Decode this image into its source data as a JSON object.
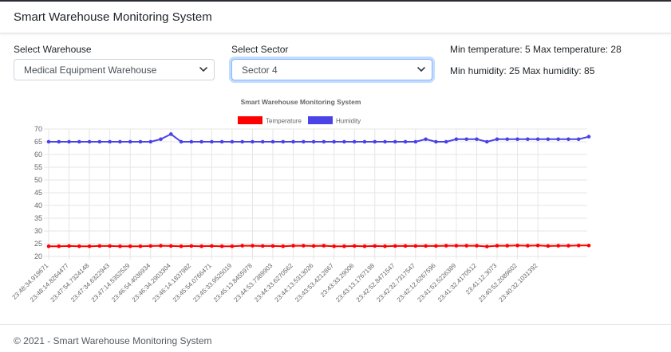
{
  "app": {
    "title": "Smart Warehouse Monitoring System"
  },
  "filters": {
    "warehouse": {
      "label": "Select Warehouse",
      "value": "Medical Equipment Warehouse"
    },
    "sector": {
      "label": "Select Sector",
      "value": "Sector 4"
    }
  },
  "ranges": {
    "temperature": "Min temperature: 5 Max temperature: 28",
    "humidity": "Min humidity: 25 Max humidity: 85"
  },
  "footer": {
    "text": "© 2021 - Smart Warehouse Monitoring System"
  },
  "colors": {
    "temperature": "#ff0000",
    "humidity": "#4a43e6",
    "grid": "#e6e6e6"
  },
  "chart_data": {
    "type": "line",
    "title": "Smart Warehouse Monitoring System",
    "legend_position": "top",
    "grid": true,
    "ylim": [
      20,
      70
    ],
    "yticks": [
      20,
      25,
      30,
      35,
      40,
      45,
      50,
      55,
      60,
      65,
      70
    ],
    "x_tick_labels": [
      "23:48:34.919671",
      "23:48:14.8264477",
      "23:47:54.7324148",
      "23:47:34.6322943",
      "23:47:14.5352529",
      "23:46:54.4036934",
      "23:46:34.2903304",
      "23:46:14.1837982",
      "23:45:54.0766471",
      "23:45:33.9525019",
      "23:45:13.8455978",
      "23:44:53.7389903",
      "23:44:33.6270562",
      "23:44:13.5313026",
      "23:43:53.4212867",
      "23:43:33.29006",
      "23:43:13.1767198",
      "23:42:52.8471547",
      "23:42:32.7317547",
      "23:42:12.6267596",
      "23:41:52.5226389",
      "23:41:32.4170512",
      "23:41:12.3073",
      "23:40:52.2089602",
      "23:40:32.1031392"
    ],
    "series": [
      {
        "name": "Temperature",
        "color": "#ff0000",
        "values": [
          24,
          24,
          24.1,
          24,
          24,
          24.1,
          24.1,
          24,
          24,
          24,
          24.1,
          24.2,
          24.1,
          24,
          24.1,
          24,
          24.1,
          24,
          24,
          24.2,
          24.2,
          24.1,
          24.1,
          24,
          24.2,
          24.2,
          24.1,
          24.2,
          24,
          24,
          24.1,
          24,
          24.1,
          24,
          24.1,
          24.1,
          24.1,
          24.1,
          24.1,
          24.2,
          24.2,
          24.2,
          24.2,
          23.9,
          24.2,
          24.2,
          24.3,
          24.2,
          24.3,
          24.1,
          24.2,
          24.2,
          24.3,
          24.3
        ]
      },
      {
        "name": "Humidity",
        "color": "#4a43e6",
        "values": [
          65,
          65,
          65,
          65,
          65,
          65,
          65,
          65,
          65,
          65,
          65,
          66,
          68,
          65,
          65,
          65,
          65,
          65,
          65,
          65,
          65,
          65,
          65,
          65,
          65,
          65,
          65,
          65,
          65,
          65,
          65,
          65,
          65,
          65,
          65,
          65,
          65,
          66,
          65,
          65,
          66,
          66,
          66,
          65,
          66,
          66,
          66,
          66,
          66,
          66,
          66,
          66,
          66,
          67
        ]
      }
    ]
  }
}
